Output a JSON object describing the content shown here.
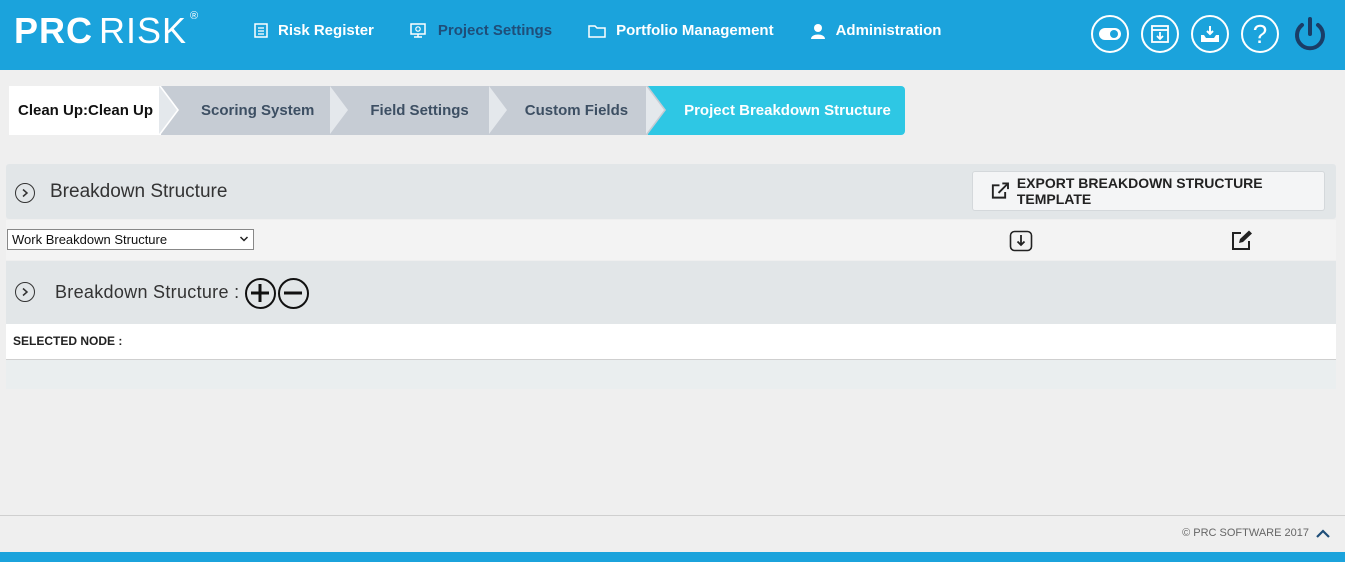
{
  "brand": {
    "part1": "PRC",
    "part2": "RISK",
    "reg": "®"
  },
  "nav": {
    "risk_register": "Risk Register",
    "project_settings": "Project Settings",
    "portfolio_management": "Portfolio Management",
    "administration": "Administration"
  },
  "header_icons": [
    "toggle-icon",
    "window-download-icon",
    "inbox-download-icon",
    "help-icon",
    "power-icon"
  ],
  "help_glyph": "?",
  "wizard": {
    "steps": [
      "Clean Up:Clean Up",
      "Scoring System",
      "Field Settings",
      "Custom Fields",
      "Project Breakdown Structure"
    ],
    "active_index": 4
  },
  "panel": {
    "title": "Breakdown Structure",
    "export_label": "EXPORT BREAKDOWN STRUCTURE TEMPLATE"
  },
  "structure_select": {
    "value": "Work Breakdown Structure"
  },
  "tree": {
    "title": "Breakdown Structure :"
  },
  "selected_node": {
    "label": "SELECTED NODE :"
  },
  "footer": {
    "copyright": "© PRC SOFTWARE 2017"
  },
  "colors": {
    "header": "#1ba3dc",
    "active_step": "#2ec7e4",
    "step": "#c6ccd4",
    "active_nav": "#1f4e79"
  }
}
